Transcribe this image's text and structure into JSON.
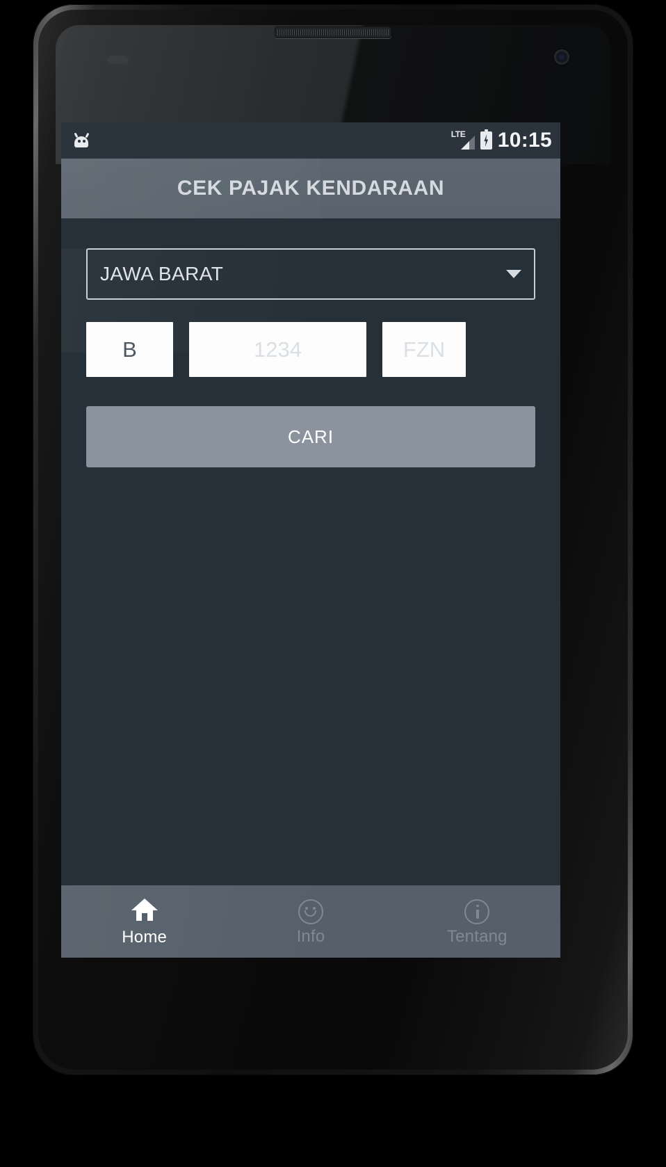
{
  "device": {
    "frame": "nexus-phone",
    "earpiece": "earpiece-speaker",
    "front_camera": "front-camera"
  },
  "status_bar": {
    "left_icon": "android-notification-icon",
    "network_label": "LTE",
    "signal_icon": "signal-bars-icon",
    "battery_icon": "battery-charging-icon",
    "time": "10:15",
    "background": "#2b343c"
  },
  "action_bar": {
    "title": "CEK PAJAK KENDARAAN",
    "background": "#5c6670",
    "title_color": "#d5dae0"
  },
  "content": {
    "background": "#263038",
    "province_spinner": {
      "label": "province-spinner",
      "value": "JAWA BARAT",
      "arrow_icon": "chevron-down-icon",
      "border_color": "#c7ced4",
      "options": [
        "JAWA BARAT"
      ]
    },
    "plate_inputs": [
      {
        "name": "plate-prefix-input",
        "value": "B",
        "placeholder": "B"
      },
      {
        "name": "plate-number-input",
        "value": "",
        "placeholder": "1234"
      },
      {
        "name": "plate-suffix-input",
        "value": "",
        "placeholder": "FZN"
      }
    ],
    "search_button": {
      "label": "CARI",
      "background": "#8a939e",
      "text_color": "#ffffff"
    }
  },
  "bottom_nav": {
    "background": "#56606a",
    "active_color": "#ffffff",
    "inactive_color": "#7f8994",
    "items": [
      {
        "label": "Home",
        "icon": "home-icon",
        "active": true
      },
      {
        "label": "Info",
        "icon": "smiley-face-icon",
        "active": false
      },
      {
        "label": "Tentang",
        "icon": "info-circle-icon",
        "active": false
      }
    ]
  },
  "system_nav": {
    "background": "#050505",
    "buttons": [
      {
        "name": "back-button",
        "icon": "triangle-back-icon"
      },
      {
        "name": "home-button",
        "icon": "circle-home-icon"
      },
      {
        "name": "recents-button",
        "icon": "square-recents-icon"
      }
    ]
  }
}
